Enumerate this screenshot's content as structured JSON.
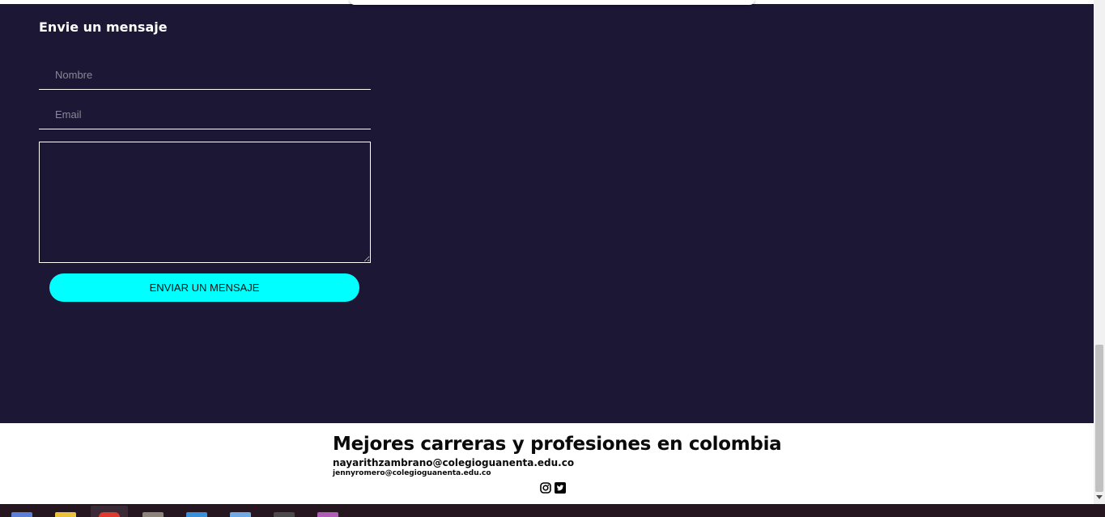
{
  "contact": {
    "title": "Envie un mensaje",
    "name_placeholder": "Nombre",
    "email_placeholder": "Email",
    "message_value": "",
    "send_label": "ENVIAR UN MENSAJE"
  },
  "footer": {
    "title": "Mejores carreras y profesiones en colombia",
    "email_primary": "nayarithzambrano@colegioguanenta.edu.co",
    "email_secondary": "jennyromero@colegioguanenta.edu.co",
    "social_icons": [
      "instagram-icon",
      "twitter-icon"
    ]
  },
  "colors": {
    "section_background": "#1c1734",
    "button_accent": "#00ffff",
    "footer_background": "#ffffff",
    "taskbar_background": "#261620"
  },
  "scrollbar": {
    "position_fraction": 0.72
  }
}
